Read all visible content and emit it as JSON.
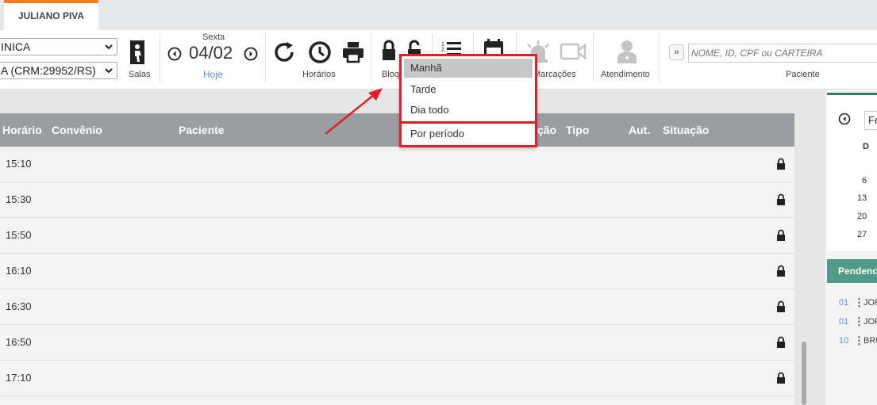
{
  "tab": {
    "label": "JULIANO PIVA"
  },
  "toolbar": {
    "clinic_select": "INICA",
    "doctor_select": "A (CRM:29952/RS)",
    "salas_label": "Salas",
    "day_of_week": "Sexta",
    "date": "04/02",
    "today_link": "Hoje",
    "horarios_label": "Horários",
    "bloq_label": "Bloq",
    "marcacoes_label": "Marcações",
    "atendimento_label": "Atendimento",
    "expand_label": "»",
    "search_placeholder": "NOME, ID, CPF ou CARTEIRA",
    "paciente_label": "Paciente"
  },
  "table": {
    "headers": {
      "horario": "Horário",
      "convenio": "Convênio",
      "paciente": "Paciente",
      "cao": "ção",
      "tipo": "Tipo",
      "aut": "Aut.",
      "situacao": "Situação"
    },
    "rows": [
      {
        "time": "15:10"
      },
      {
        "time": "15:30"
      },
      {
        "time": "15:50"
      },
      {
        "time": "16:10"
      },
      {
        "time": "16:30"
      },
      {
        "time": "16:50"
      },
      {
        "time": "17:10"
      }
    ]
  },
  "dropdown": {
    "items": [
      "Manhã",
      "Tarde",
      "Dia todo",
      "Por período"
    ]
  },
  "calendar": {
    "month": "Fe",
    "day_header": "D",
    "days": [
      "6",
      "13",
      "20",
      "27"
    ]
  },
  "pendencias": {
    "title": "Pendencias",
    "items": [
      {
        "num": "01",
        "name": "JOR"
      },
      {
        "num": "01",
        "name": "JOR"
      },
      {
        "num": "10",
        "name": "BRU"
      }
    ]
  },
  "colors": {
    "tab_accent": "#f57f20",
    "header_gray": "#9a9ea3",
    "highlight_red": "#e41e25",
    "pend_green": "#4f9a89",
    "link_blue": "#5b8fd6"
  }
}
